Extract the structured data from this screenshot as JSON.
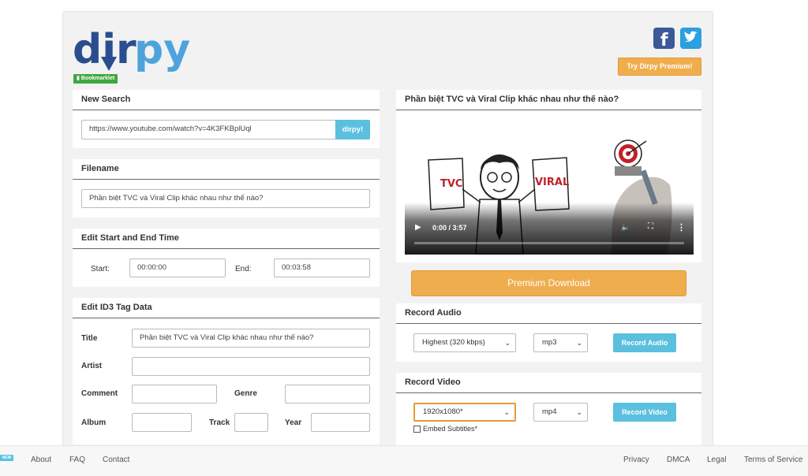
{
  "header": {
    "logo_text_a": "dir",
    "logo_text_b": "py",
    "bookmarklet": "Bookmarklet",
    "try_premium": "Try Dirpy Premium!"
  },
  "new_search": {
    "title": "New Search",
    "url": "https://www.youtube.com/watch?v=4K3FKBplUql",
    "button": "dirpy!"
  },
  "filename": {
    "title": "Filename",
    "value": "Phần biệt TVC và Viral Clip khác nhau như thế nào?"
  },
  "edit_time": {
    "title": "Edit Start and End Time",
    "start_label": "Start:",
    "start_value": "00:00:00",
    "end_label": "End:",
    "end_value": "00:03:58"
  },
  "id3": {
    "title": "Edit ID3 Tag Data",
    "title_label": "Title",
    "title_value": "Phần biệt TVC và Viral Clip khác nhau như thế nào?",
    "artist_label": "Artist",
    "comment_label": "Comment",
    "genre_label": "Genre",
    "album_label": "Album",
    "track_label": "Track",
    "year_label": "Year"
  },
  "video": {
    "title": "Phần biệt TVC và Viral Clip khác nhau như thế nào?",
    "time": "0:00 / 3:57",
    "left_sign": "TVC",
    "right_sign": "VIRAL"
  },
  "premium_download": "Premium Download",
  "record_audio": {
    "title": "Record Audio",
    "quality": "Highest (320 kbps)",
    "format": "mp3",
    "button": "Record Audio"
  },
  "record_video": {
    "title": "Record Video",
    "resolution": "1920x1080*",
    "format": "mp4",
    "button": "Record Video",
    "embed_subtitles": "Embed Subtitles*"
  },
  "footer": {
    "new_badge": "NEW",
    "left_links": [
      "About",
      "FAQ",
      "Contact"
    ],
    "right_links": [
      "Privacy",
      "DMCA",
      "Legal",
      "Terms of Service"
    ]
  },
  "colors": {
    "brand_blue": "#2a4d8f",
    "brand_light": "#4fa3dc",
    "accent_orange": "#f0ad4e",
    "button_blue": "#5bc0de"
  }
}
